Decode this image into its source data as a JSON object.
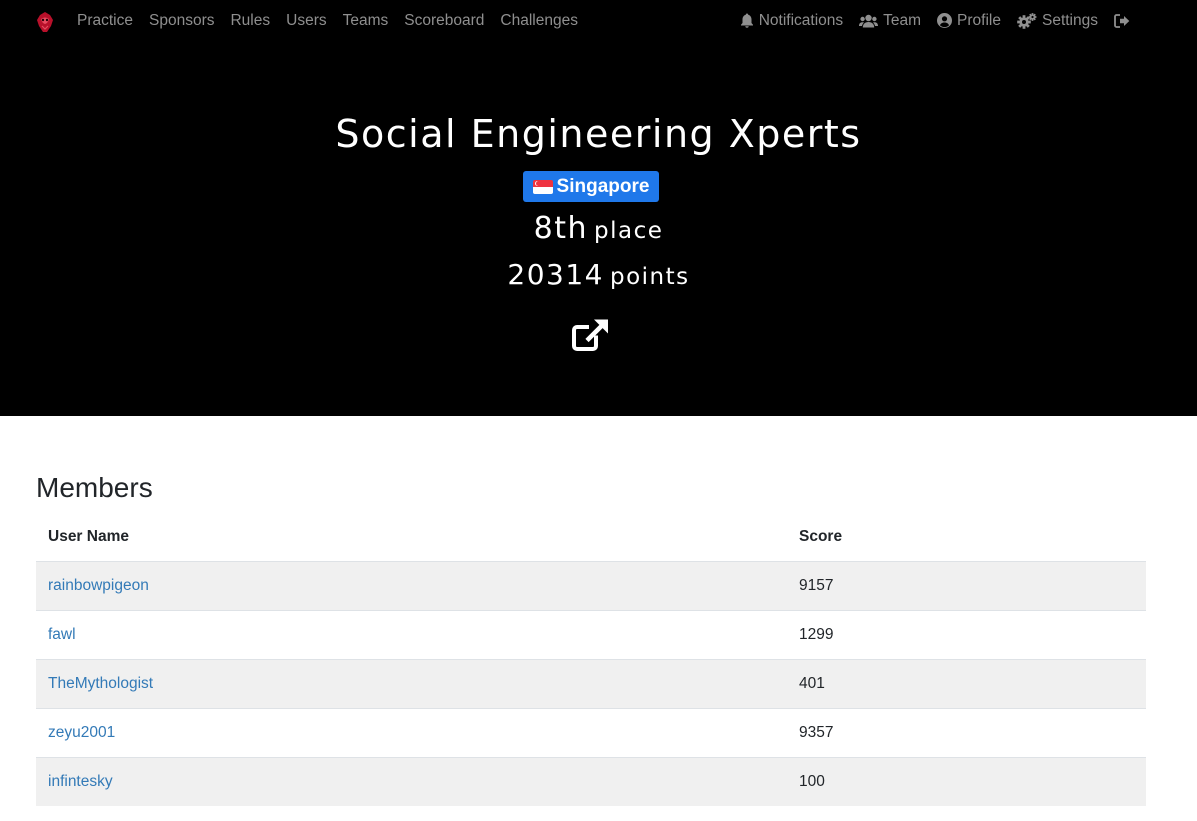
{
  "nav": {
    "brand_icon": "ctf-logo-icon",
    "left_items": [
      {
        "label": "Practice"
      },
      {
        "label": "Sponsors"
      },
      {
        "label": "Rules"
      },
      {
        "label": "Users"
      },
      {
        "label": "Teams"
      },
      {
        "label": "Scoreboard"
      },
      {
        "label": "Challenges"
      }
    ],
    "right_items": {
      "notifications": {
        "label": "Notifications",
        "icon": "bell-icon"
      },
      "team": {
        "label": "Team",
        "icon": "users-icon"
      },
      "profile": {
        "label": "Profile",
        "icon": "user-circle-icon"
      },
      "settings": {
        "label": "Settings",
        "icon": "cogs-icon"
      },
      "logout": {
        "label": "",
        "icon": "sign-out-icon"
      }
    }
  },
  "team": {
    "name": "Social Engineering Xperts",
    "country": "Singapore",
    "country_flag_icon": "singapore-flag-icon",
    "place_number": "8th",
    "place_label": "place",
    "points_number": "20314",
    "points_label": "points",
    "website_icon": "external-link-icon"
  },
  "members": {
    "title": "Members",
    "columns": {
      "name": "User Name",
      "score": "Score"
    },
    "rows": [
      {
        "name": "rainbowpigeon",
        "score": "9157"
      },
      {
        "name": "fawl",
        "score": "1299"
      },
      {
        "name": "TheMythologist",
        "score": "401"
      },
      {
        "name": "zeyu2001",
        "score": "9357"
      },
      {
        "name": "infintesky",
        "score": "100"
      }
    ]
  },
  "colors": {
    "navbar_bg": "#000000",
    "nav_text": "#8f8f8f",
    "badge_bg": "#1f78ea",
    "link": "#337ab7",
    "row_stripe": "#f0f0f0"
  }
}
